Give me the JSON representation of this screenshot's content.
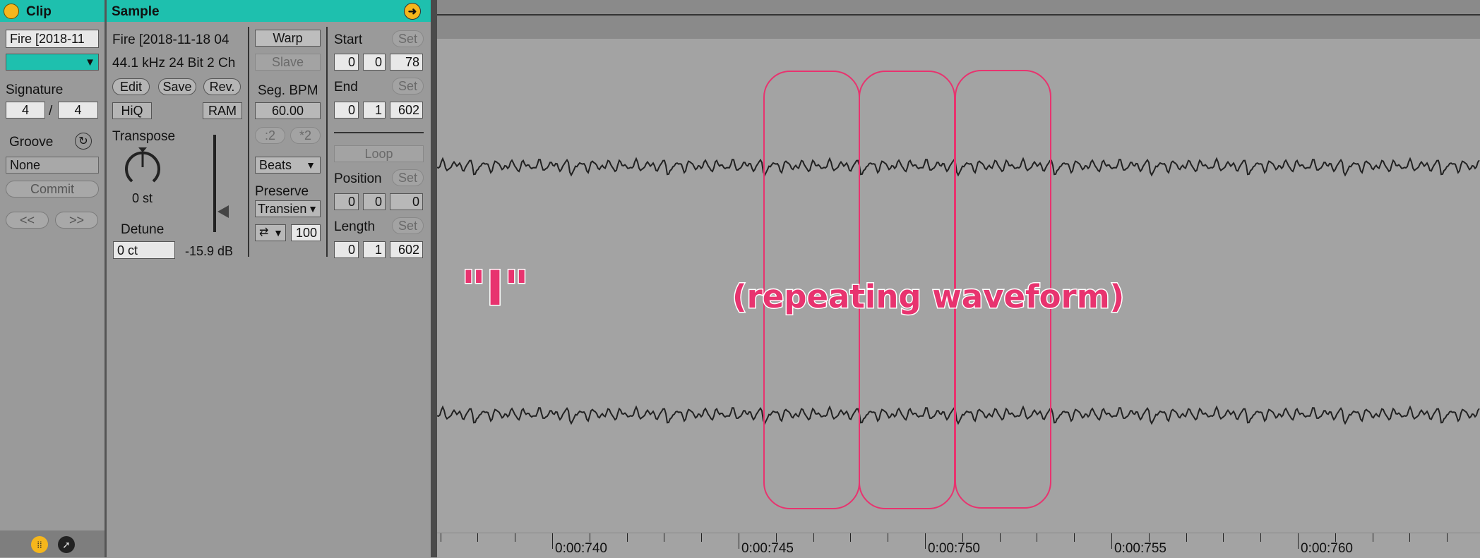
{
  "clip": {
    "title": "Clip",
    "name": "Fire [2018-11",
    "signature_label": "Signature",
    "sig_num": "4",
    "sig_sep": "/",
    "sig_den": "4",
    "groove_label": "Groove",
    "groove_value": "None",
    "commit_label": "Commit",
    "prev_label": "<<",
    "next_label": ">>",
    "color": "#1ec0ae"
  },
  "sample": {
    "title": "Sample",
    "filename": "Fire [2018-11-18 04",
    "format": "44.1 kHz 24 Bit 2 Ch",
    "edit_label": "Edit",
    "save_label": "Save",
    "rev_label": "Rev.",
    "hiq_label": "HiQ",
    "ram_label": "RAM",
    "transpose_label": "Transpose",
    "transpose_value": "0 st",
    "detune_label": "Detune",
    "detune_value": "0 ct",
    "gain_value": "-15.9 dB",
    "warp_label": "Warp",
    "slave_label": "Slave",
    "seg_bpm_label": "Seg. BPM",
    "seg_bpm_value": "60.00",
    "half_label": ":2",
    "double_label": "*2",
    "warp_mode": "Beats",
    "preserve_label": "Preserve",
    "preserve_value": "Transien",
    "loop_mode_value": "100",
    "start_label": "Start",
    "start": [
      "0",
      "0",
      "78"
    ],
    "end_label": "End",
    "end": [
      "0",
      "1",
      "602"
    ],
    "loop_label": "Loop",
    "position_label": "Position",
    "position": [
      "0",
      "0",
      "0"
    ],
    "length_label": "Length",
    "length": [
      "0",
      "1",
      "602"
    ],
    "set_label": "Set"
  },
  "waveform": {
    "annotation_main": "(repeating waveform)",
    "annotation_letter": "\"I\"",
    "highlight_color": "#e8336f",
    "time_labels": [
      "0:00:740",
      "0:00:745",
      "0:00:750",
      "0:00:755",
      "0:00:760"
    ]
  }
}
